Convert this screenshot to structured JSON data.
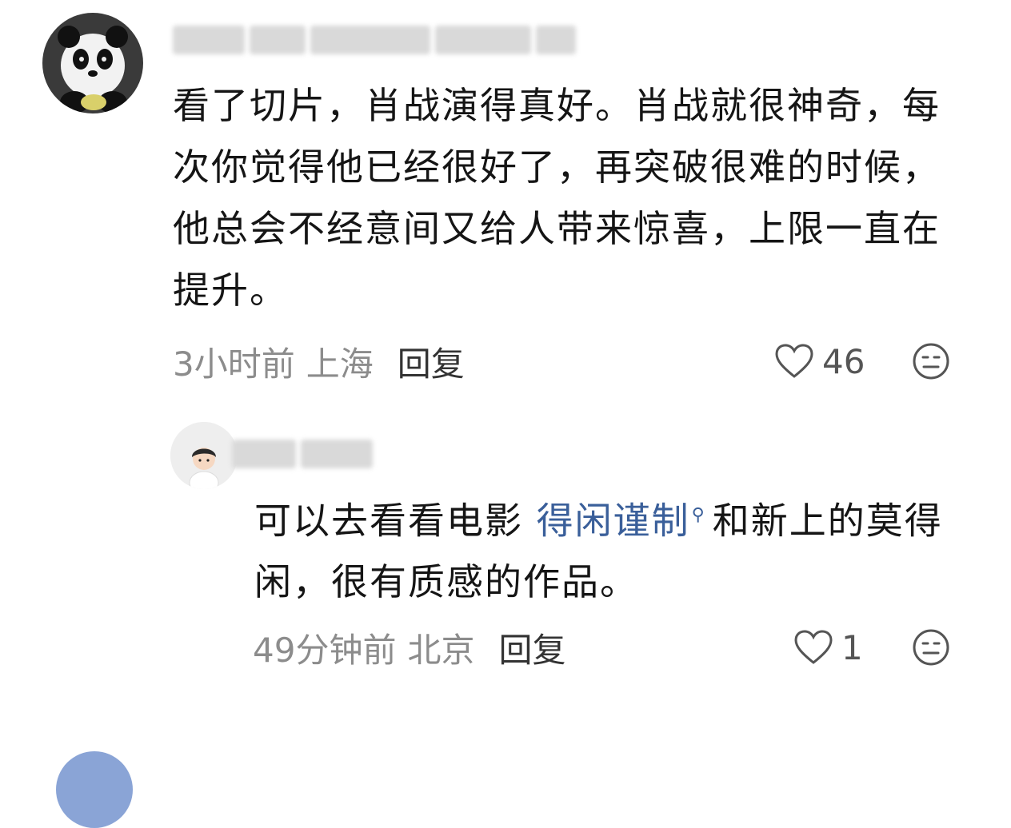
{
  "comments": [
    {
      "avatar_icon": "panda-avatar",
      "text": "看了切片，肖战演得真好。肖战就很神奇，每次你觉得他已经很好了，再突破很难的时候，他总会不经意间又给人带来惊喜，上限一直在提升。",
      "time": "3小时前",
      "location": "上海",
      "reply_label": "回复",
      "like_count": "46"
    }
  ],
  "reply": {
    "avatar_icon": "boy-avatar",
    "text_before": "可以去看看电影 ",
    "link_text": "得闲谨制",
    "link_icon": "search-icon",
    "text_after": "和新上的莫得闲，很有质感的作品。",
    "time": "49分钟前",
    "location": "北京",
    "reply_label": "回复",
    "like_count": "1"
  },
  "icons": {
    "like": "heart-outline-icon",
    "dislike": "neutral-face-icon"
  }
}
